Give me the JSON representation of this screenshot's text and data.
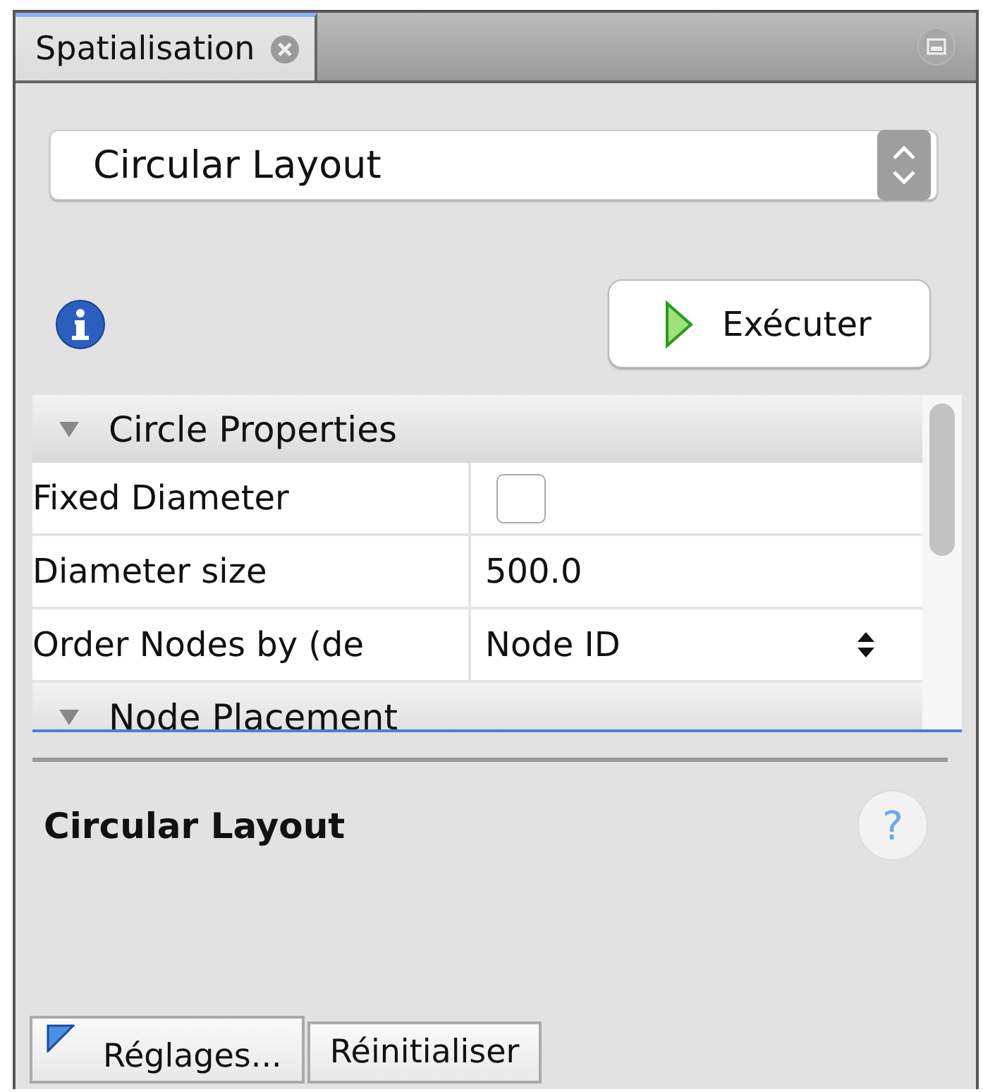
{
  "tab": {
    "title": "Spatialisation",
    "selected": true
  },
  "layout_select": {
    "value": "Circular Layout"
  },
  "run_button": {
    "label": "Exécuter"
  },
  "properties": [
    {
      "title": "Circle Properties",
      "expanded": true,
      "rows": [
        {
          "kind": "checkbox",
          "name": "Fixed Diameter",
          "checked": false
        },
        {
          "kind": "text",
          "name": "Diameter size",
          "value": "500.0"
        },
        {
          "kind": "combo",
          "name": "Order Nodes by (de",
          "value": "Node ID"
        }
      ]
    },
    {
      "title": "Node Placement",
      "expanded": true
    }
  ],
  "description": {
    "title": "Circular Layout",
    "help": "?"
  },
  "buttons": [
    {
      "kind": "presets",
      "label": "Réglages..."
    },
    {
      "kind": "plain",
      "label": "Réinitialiser"
    }
  ]
}
